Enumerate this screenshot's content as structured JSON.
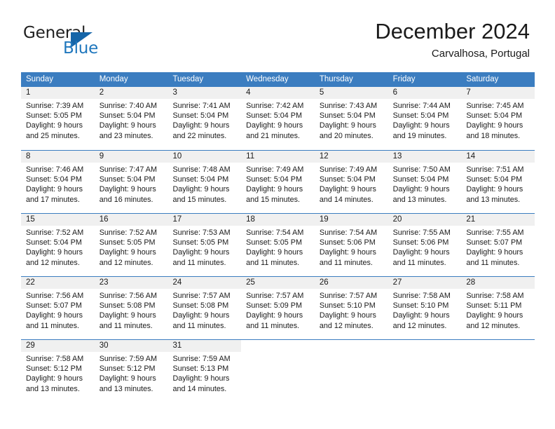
{
  "brand": {
    "word1": "General",
    "word2": "Blue",
    "logo_icon": "triangle-logo-icon",
    "accent_color": "#1565a8",
    "blue_text_color": "#1f77bd"
  },
  "header": {
    "title": "December 2024",
    "subtitle": "Carvalhosa, Portugal"
  },
  "calendar": {
    "header_bg": "#3b7dc0",
    "day_number_bg": "#f0f0f0",
    "weekday_names": [
      "Sunday",
      "Monday",
      "Tuesday",
      "Wednesday",
      "Thursday",
      "Friday",
      "Saturday"
    ],
    "weeks": [
      [
        {
          "day": "1",
          "sunrise": "Sunrise: 7:39 AM",
          "sunset": "Sunset: 5:05 PM",
          "daylight_line1": "Daylight: 9 hours",
          "daylight_line2": "and 25 minutes."
        },
        {
          "day": "2",
          "sunrise": "Sunrise: 7:40 AM",
          "sunset": "Sunset: 5:04 PM",
          "daylight_line1": "Daylight: 9 hours",
          "daylight_line2": "and 23 minutes."
        },
        {
          "day": "3",
          "sunrise": "Sunrise: 7:41 AM",
          "sunset": "Sunset: 5:04 PM",
          "daylight_line1": "Daylight: 9 hours",
          "daylight_line2": "and 22 minutes."
        },
        {
          "day": "4",
          "sunrise": "Sunrise: 7:42 AM",
          "sunset": "Sunset: 5:04 PM",
          "daylight_line1": "Daylight: 9 hours",
          "daylight_line2": "and 21 minutes."
        },
        {
          "day": "5",
          "sunrise": "Sunrise: 7:43 AM",
          "sunset": "Sunset: 5:04 PM",
          "daylight_line1": "Daylight: 9 hours",
          "daylight_line2": "and 20 minutes."
        },
        {
          "day": "6",
          "sunrise": "Sunrise: 7:44 AM",
          "sunset": "Sunset: 5:04 PM",
          "daylight_line1": "Daylight: 9 hours",
          "daylight_line2": "and 19 minutes."
        },
        {
          "day": "7",
          "sunrise": "Sunrise: 7:45 AM",
          "sunset": "Sunset: 5:04 PM",
          "daylight_line1": "Daylight: 9 hours",
          "daylight_line2": "and 18 minutes."
        }
      ],
      [
        {
          "day": "8",
          "sunrise": "Sunrise: 7:46 AM",
          "sunset": "Sunset: 5:04 PM",
          "daylight_line1": "Daylight: 9 hours",
          "daylight_line2": "and 17 minutes."
        },
        {
          "day": "9",
          "sunrise": "Sunrise: 7:47 AM",
          "sunset": "Sunset: 5:04 PM",
          "daylight_line1": "Daylight: 9 hours",
          "daylight_line2": "and 16 minutes."
        },
        {
          "day": "10",
          "sunrise": "Sunrise: 7:48 AM",
          "sunset": "Sunset: 5:04 PM",
          "daylight_line1": "Daylight: 9 hours",
          "daylight_line2": "and 15 minutes."
        },
        {
          "day": "11",
          "sunrise": "Sunrise: 7:49 AM",
          "sunset": "Sunset: 5:04 PM",
          "daylight_line1": "Daylight: 9 hours",
          "daylight_line2": "and 15 minutes."
        },
        {
          "day": "12",
          "sunrise": "Sunrise: 7:49 AM",
          "sunset": "Sunset: 5:04 PM",
          "daylight_line1": "Daylight: 9 hours",
          "daylight_line2": "and 14 minutes."
        },
        {
          "day": "13",
          "sunrise": "Sunrise: 7:50 AM",
          "sunset": "Sunset: 5:04 PM",
          "daylight_line1": "Daylight: 9 hours",
          "daylight_line2": "and 13 minutes."
        },
        {
          "day": "14",
          "sunrise": "Sunrise: 7:51 AM",
          "sunset": "Sunset: 5:04 PM",
          "daylight_line1": "Daylight: 9 hours",
          "daylight_line2": "and 13 minutes."
        }
      ],
      [
        {
          "day": "15",
          "sunrise": "Sunrise: 7:52 AM",
          "sunset": "Sunset: 5:04 PM",
          "daylight_line1": "Daylight: 9 hours",
          "daylight_line2": "and 12 minutes."
        },
        {
          "day": "16",
          "sunrise": "Sunrise: 7:52 AM",
          "sunset": "Sunset: 5:05 PM",
          "daylight_line1": "Daylight: 9 hours",
          "daylight_line2": "and 12 minutes."
        },
        {
          "day": "17",
          "sunrise": "Sunrise: 7:53 AM",
          "sunset": "Sunset: 5:05 PM",
          "daylight_line1": "Daylight: 9 hours",
          "daylight_line2": "and 11 minutes."
        },
        {
          "day": "18",
          "sunrise": "Sunrise: 7:54 AM",
          "sunset": "Sunset: 5:05 PM",
          "daylight_line1": "Daylight: 9 hours",
          "daylight_line2": "and 11 minutes."
        },
        {
          "day": "19",
          "sunrise": "Sunrise: 7:54 AM",
          "sunset": "Sunset: 5:06 PM",
          "daylight_line1": "Daylight: 9 hours",
          "daylight_line2": "and 11 minutes."
        },
        {
          "day": "20",
          "sunrise": "Sunrise: 7:55 AM",
          "sunset": "Sunset: 5:06 PM",
          "daylight_line1": "Daylight: 9 hours",
          "daylight_line2": "and 11 minutes."
        },
        {
          "day": "21",
          "sunrise": "Sunrise: 7:55 AM",
          "sunset": "Sunset: 5:07 PM",
          "daylight_line1": "Daylight: 9 hours",
          "daylight_line2": "and 11 minutes."
        }
      ],
      [
        {
          "day": "22",
          "sunrise": "Sunrise: 7:56 AM",
          "sunset": "Sunset: 5:07 PM",
          "daylight_line1": "Daylight: 9 hours",
          "daylight_line2": "and 11 minutes."
        },
        {
          "day": "23",
          "sunrise": "Sunrise: 7:56 AM",
          "sunset": "Sunset: 5:08 PM",
          "daylight_line1": "Daylight: 9 hours",
          "daylight_line2": "and 11 minutes."
        },
        {
          "day": "24",
          "sunrise": "Sunrise: 7:57 AM",
          "sunset": "Sunset: 5:08 PM",
          "daylight_line1": "Daylight: 9 hours",
          "daylight_line2": "and 11 minutes."
        },
        {
          "day": "25",
          "sunrise": "Sunrise: 7:57 AM",
          "sunset": "Sunset: 5:09 PM",
          "daylight_line1": "Daylight: 9 hours",
          "daylight_line2": "and 11 minutes."
        },
        {
          "day": "26",
          "sunrise": "Sunrise: 7:57 AM",
          "sunset": "Sunset: 5:10 PM",
          "daylight_line1": "Daylight: 9 hours",
          "daylight_line2": "and 12 minutes."
        },
        {
          "day": "27",
          "sunrise": "Sunrise: 7:58 AM",
          "sunset": "Sunset: 5:10 PM",
          "daylight_line1": "Daylight: 9 hours",
          "daylight_line2": "and 12 minutes."
        },
        {
          "day": "28",
          "sunrise": "Sunrise: 7:58 AM",
          "sunset": "Sunset: 5:11 PM",
          "daylight_line1": "Daylight: 9 hours",
          "daylight_line2": "and 12 minutes."
        }
      ],
      [
        {
          "day": "29",
          "sunrise": "Sunrise: 7:58 AM",
          "sunset": "Sunset: 5:12 PM",
          "daylight_line1": "Daylight: 9 hours",
          "daylight_line2": "and 13 minutes."
        },
        {
          "day": "30",
          "sunrise": "Sunrise: 7:59 AM",
          "sunset": "Sunset: 5:12 PM",
          "daylight_line1": "Daylight: 9 hours",
          "daylight_line2": "and 13 minutes."
        },
        {
          "day": "31",
          "sunrise": "Sunrise: 7:59 AM",
          "sunset": "Sunset: 5:13 PM",
          "daylight_line1": "Daylight: 9 hours",
          "daylight_line2": "and 14 minutes."
        },
        {
          "day": "",
          "sunrise": "",
          "sunset": "",
          "daylight_line1": "",
          "daylight_line2": ""
        },
        {
          "day": "",
          "sunrise": "",
          "sunset": "",
          "daylight_line1": "",
          "daylight_line2": ""
        },
        {
          "day": "",
          "sunrise": "",
          "sunset": "",
          "daylight_line1": "",
          "daylight_line2": ""
        },
        {
          "day": "",
          "sunrise": "",
          "sunset": "",
          "daylight_line1": "",
          "daylight_line2": ""
        }
      ]
    ]
  }
}
